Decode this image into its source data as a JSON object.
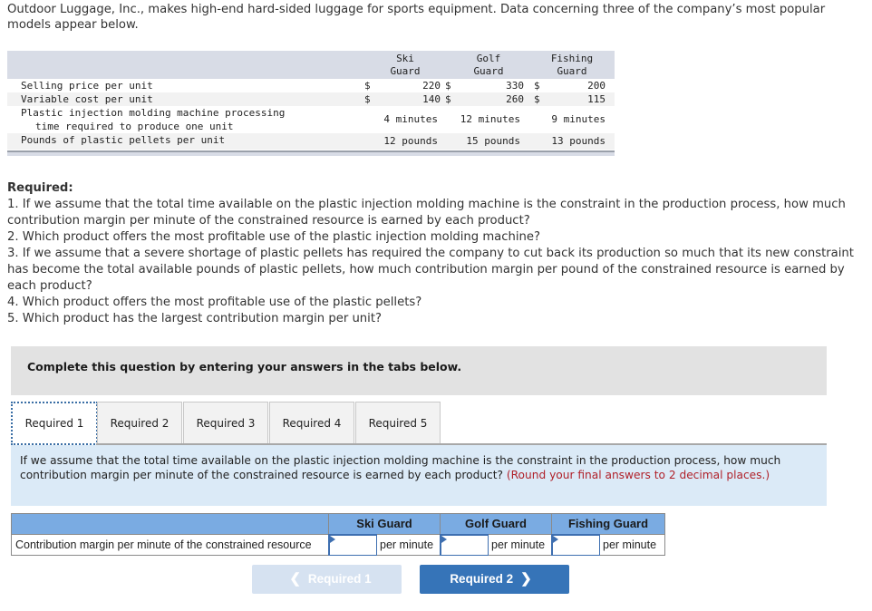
{
  "intro": "Outdoor Luggage, Inc., makes high-end hard-sided luggage for sports equipment. Data concerning three of the company’s most popular models appear below.",
  "data_table": {
    "columns": [
      {
        "line1": "Ski",
        "line2": "Guard"
      },
      {
        "line1": "Golf",
        "line2": "Guard"
      },
      {
        "line1": "Fishing",
        "line2": "Guard"
      }
    ],
    "rows": [
      {
        "label": "Selling price per unit",
        "currency": "$",
        "values": [
          "220",
          "330",
          "200"
        ]
      },
      {
        "label": "Variable cost per unit",
        "currency": "$",
        "values": [
          "140",
          "260",
          "115"
        ]
      },
      {
        "label_line1": "Plastic injection molding machine processing",
        "label_line2": "time required to produce one unit",
        "values": [
          "4 minutes",
          "12 minutes",
          "9 minutes"
        ]
      },
      {
        "label": "Pounds of plastic pellets per unit",
        "values": [
          "12 pounds",
          "15 pounds",
          "13 pounds"
        ]
      }
    ]
  },
  "required": {
    "title": "Required:",
    "items": [
      "1. If we assume that the total time available on the plastic injection molding machine is the constraint in the production process, how much contribution margin per minute of the constrained resource is earned by each product?",
      "2. Which product offers the most profitable use of the plastic injection molding machine?",
      "3. If we assume that a severe shortage of plastic pellets has required the company to cut back its production so much that its new constraint has become the total available pounds of plastic pellets, how much contribution margin per pound of the constrained resource is earned by each product?",
      "4. Which product offers the most profitable use of the plastic pellets?",
      "5. Which product has the largest contribution margin per unit?"
    ]
  },
  "instruction_banner": "Complete this question by entering your answers in the tabs below.",
  "tabs": [
    {
      "label": "Required 1",
      "active": true
    },
    {
      "label": "Required 2",
      "active": false
    },
    {
      "label": "Required 3",
      "active": false
    },
    {
      "label": "Required 4",
      "active": false
    },
    {
      "label": "Required 5",
      "active": false
    }
  ],
  "prompt": {
    "text": "If we assume that the total time available on the plastic injection molding machine is the constraint in the production process, how much contribution margin per minute of the constrained resource is earned by each product?",
    "hint": "(Round your final answers to 2 decimal places.)"
  },
  "answer_table": {
    "headers": [
      "Ski Guard",
      "Golf Guard",
      "Fishing Guard"
    ],
    "row_label": "Contribution margin per minute of the constrained resource",
    "inputs": [
      {
        "value": "",
        "unit": "per minute"
      },
      {
        "value": "",
        "unit": "per minute"
      },
      {
        "value": "",
        "unit": "per minute"
      }
    ]
  },
  "navigation": {
    "prev_label": "Required 1",
    "next_label": "Required 2",
    "prev_icon": "chevron-left-icon",
    "next_icon": "chevron-right-icon"
  }
}
